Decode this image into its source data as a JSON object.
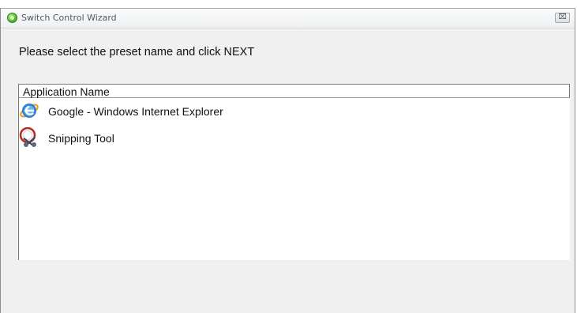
{
  "window": {
    "title": "Switch Control Wizard",
    "close_glyph": "⌧"
  },
  "prompt": "Please select the preset name and click NEXT",
  "list": {
    "column_header": "Application Name",
    "items": [
      {
        "label": "Google - Windows Internet Explorer",
        "icon": "internet-explorer-icon"
      },
      {
        "label": "Snipping Tool",
        "icon": "snipping-tool-icon"
      }
    ]
  },
  "colors": {
    "window_bg": "#f0f0f0",
    "list_bg": "#ffffff",
    "ie_blue": "#1f6fc7",
    "ie_orange": "#f0a020",
    "snip_red": "#c0261c"
  }
}
